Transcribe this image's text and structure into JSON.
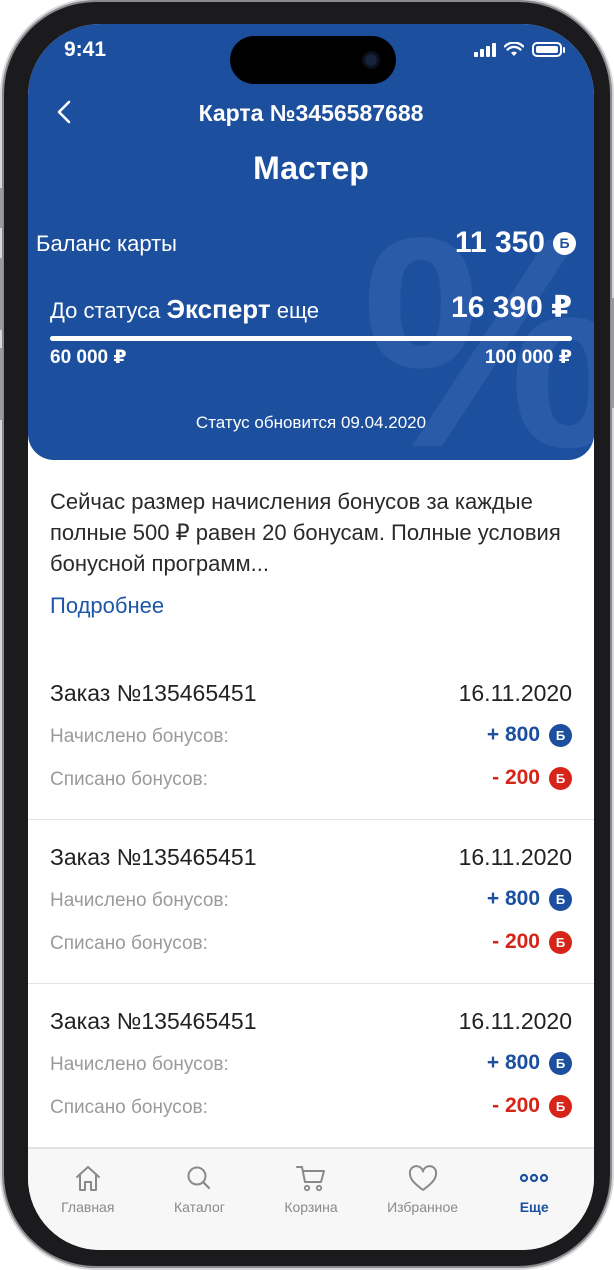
{
  "status_bar": {
    "time": "9:41"
  },
  "header": {
    "title": "Карта №3456587688",
    "level": "Мастер",
    "balance_label": "Баланс карты",
    "balance_value": "11 350",
    "bonus_symbol": "Б",
    "to_status_prefix": "До статуса",
    "next_status": "Эксперт",
    "to_status_suffix": "еще",
    "to_status_amount": "16 390 ₽",
    "range_from": "60 000 ₽",
    "range_to": "100 000 ₽",
    "progress_fraction": 1.0,
    "status_update": "Статус обновится 09.04.2020",
    "watermark": "%"
  },
  "info": {
    "text": "Сейчас размер начисления бонусов за каждые полные 500 ₽ равен 20 бонусам. Полные условия бонусной программ...",
    "more_link": "Подробнее"
  },
  "orders": [
    {
      "number": "Заказ №135465451",
      "date": "16.11.2020",
      "accrued_label": "Начислено бонусов:",
      "accrued_value": "+ 800",
      "debited_label": "Списано бонусов:",
      "debited_value": "- 200"
    },
    {
      "number": "Заказ №135465451",
      "date": "16.11.2020",
      "accrued_label": "Начислено бонусов:",
      "accrued_value": "+ 800",
      "debited_label": "Списано бонусов:",
      "debited_value": "- 200"
    },
    {
      "number": "Заказ №135465451",
      "date": "16.11.2020",
      "accrued_label": "Начислено бонусов:",
      "accrued_value": "+ 800",
      "debited_label": "Списано бонусов:",
      "debited_value": "- 200"
    }
  ],
  "tabbar": {
    "items": [
      {
        "label": "Главная",
        "icon": "home-icon"
      },
      {
        "label": "Каталог",
        "icon": "search-icon"
      },
      {
        "label": "Корзина",
        "icon": "cart-icon"
      },
      {
        "label": "Избранное",
        "icon": "heart-icon"
      },
      {
        "label": "Еще",
        "icon": "more-icon",
        "active": true
      }
    ]
  },
  "colors": {
    "brand_blue": "#1c4f9e",
    "debit_red": "#d72418",
    "link_blue": "#1d56a6"
  }
}
